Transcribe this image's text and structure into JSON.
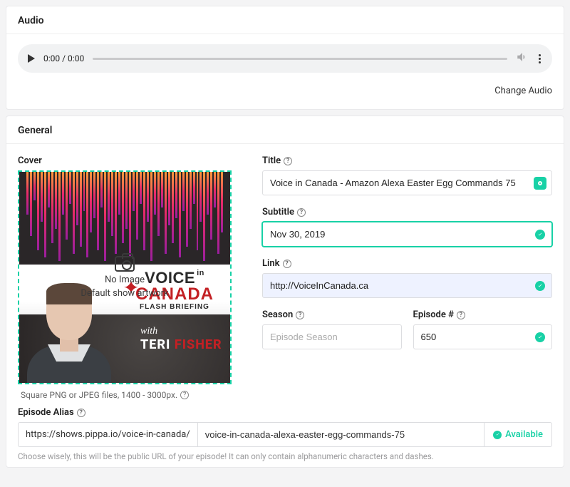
{
  "audio": {
    "section_title": "Audio",
    "time_display": "0:00 / 0:00",
    "change_link": "Change Audio"
  },
  "general": {
    "section_title": "General",
    "cover": {
      "label": "Cover",
      "no_image_line1": "No Image",
      "no_image_line2": "Default show artwork",
      "caption": "Square PNG or JPEG files, 1400 - 3000px.",
      "art_voice": "VOICE",
      "art_in": "in",
      "art_canada": "CANADA",
      "art_sub": "FLASH BRIEFING",
      "art_with": "with",
      "art_name1": "TERI",
      "art_name2": "FISHER"
    },
    "title": {
      "label": "Title",
      "value": "Voice in Canada - Amazon Alexa Easter Egg Commands 75"
    },
    "subtitle": {
      "label": "Subtitle",
      "value": "Nov 30, 2019"
    },
    "link": {
      "label": "Link",
      "value": "http://VoiceInCanada.ca"
    },
    "season": {
      "label": "Season",
      "placeholder": "Episode Season",
      "value": ""
    },
    "episode_num": {
      "label": "Episode #",
      "value": "650"
    },
    "alias": {
      "label": "Episode Alias",
      "prefix": "https://shows.pippa.io/voice-in-canada/",
      "value": "voice-in-canada-alexa-easter-egg-commands-75",
      "status": "Available",
      "hint": "Choose wisely, this will be the public URL of your episode! It can only contain alphanumeric characters and dashes."
    }
  }
}
